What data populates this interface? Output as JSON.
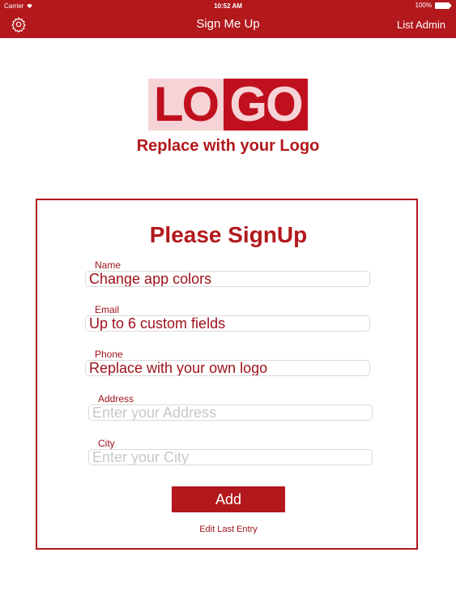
{
  "status_bar": {
    "carrier": "Carrier",
    "time": "10:52 AM",
    "battery": "100%"
  },
  "nav": {
    "title": "Sign Me Up",
    "right_label": "List Admin",
    "left_icon": "gear-icon"
  },
  "logo": {
    "part1": "LO",
    "part2": "GO",
    "subtitle": "Replace with your Logo"
  },
  "form": {
    "title": "Please SignUp",
    "fields": [
      {
        "label": "Name",
        "value": "Change app colors",
        "placeholder": ""
      },
      {
        "label": "Email",
        "value": "Up to 6 custom fields",
        "placeholder": ""
      },
      {
        "label": "Phone",
        "value": "Replace with your own logo",
        "placeholder": ""
      },
      {
        "label": "Address",
        "value": "",
        "placeholder": "Enter your Address"
      },
      {
        "label": "City",
        "value": "",
        "placeholder": "Enter your City"
      }
    ],
    "add_label": "Add",
    "edit_label": "Edit Last Entry"
  },
  "colors": {
    "accent": "#b2181c",
    "logo_light": "#f6d3d6",
    "logo_dark": "#c0101e"
  }
}
